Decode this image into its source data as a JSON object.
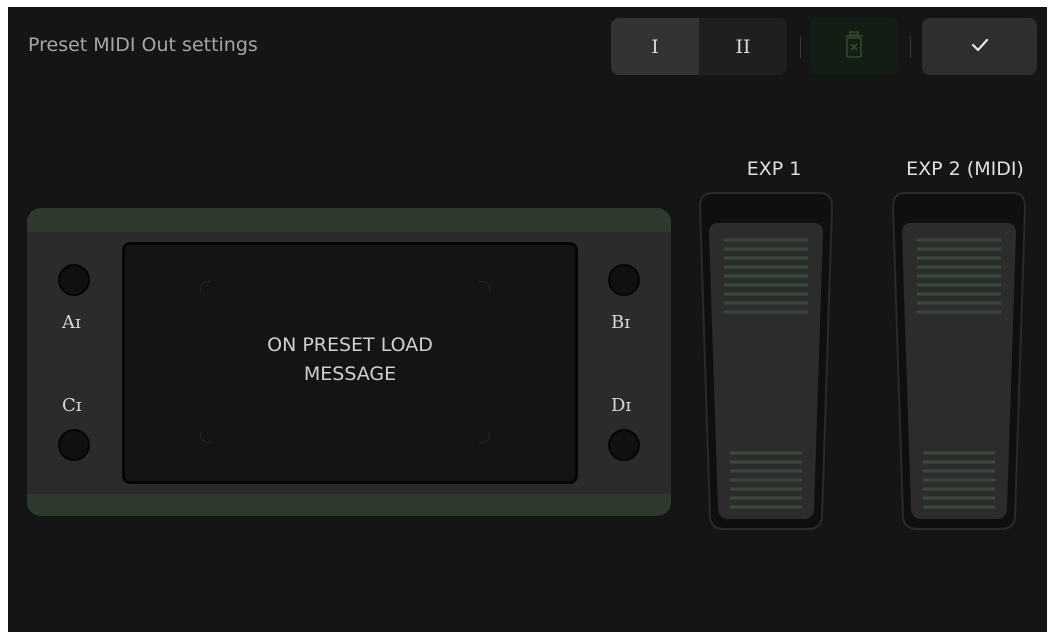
{
  "header": {
    "title": "Preset MIDI Out settings",
    "bank_buttons": [
      "I",
      "II"
    ],
    "selected_bank": "I",
    "delete_icon": "trash-x-icon",
    "confirm_icon": "checkmark-icon"
  },
  "board": {
    "screen_message_line1": "ON PRESET LOAD",
    "screen_message_line2": "MESSAGE",
    "footswitches": {
      "a": "Aɪ",
      "b": "Bɪ",
      "c": "Cɪ",
      "d": "Dɪ"
    }
  },
  "expression": {
    "exp1_label": "EXP 1",
    "exp2_label": "EXP 2 (MIDI)"
  },
  "colors": {
    "background": "#151515",
    "board": "#2b2b2b",
    "board_accent": "#2e3a2e",
    "delete_button": "#131d13",
    "text": "#e0e0e0"
  }
}
